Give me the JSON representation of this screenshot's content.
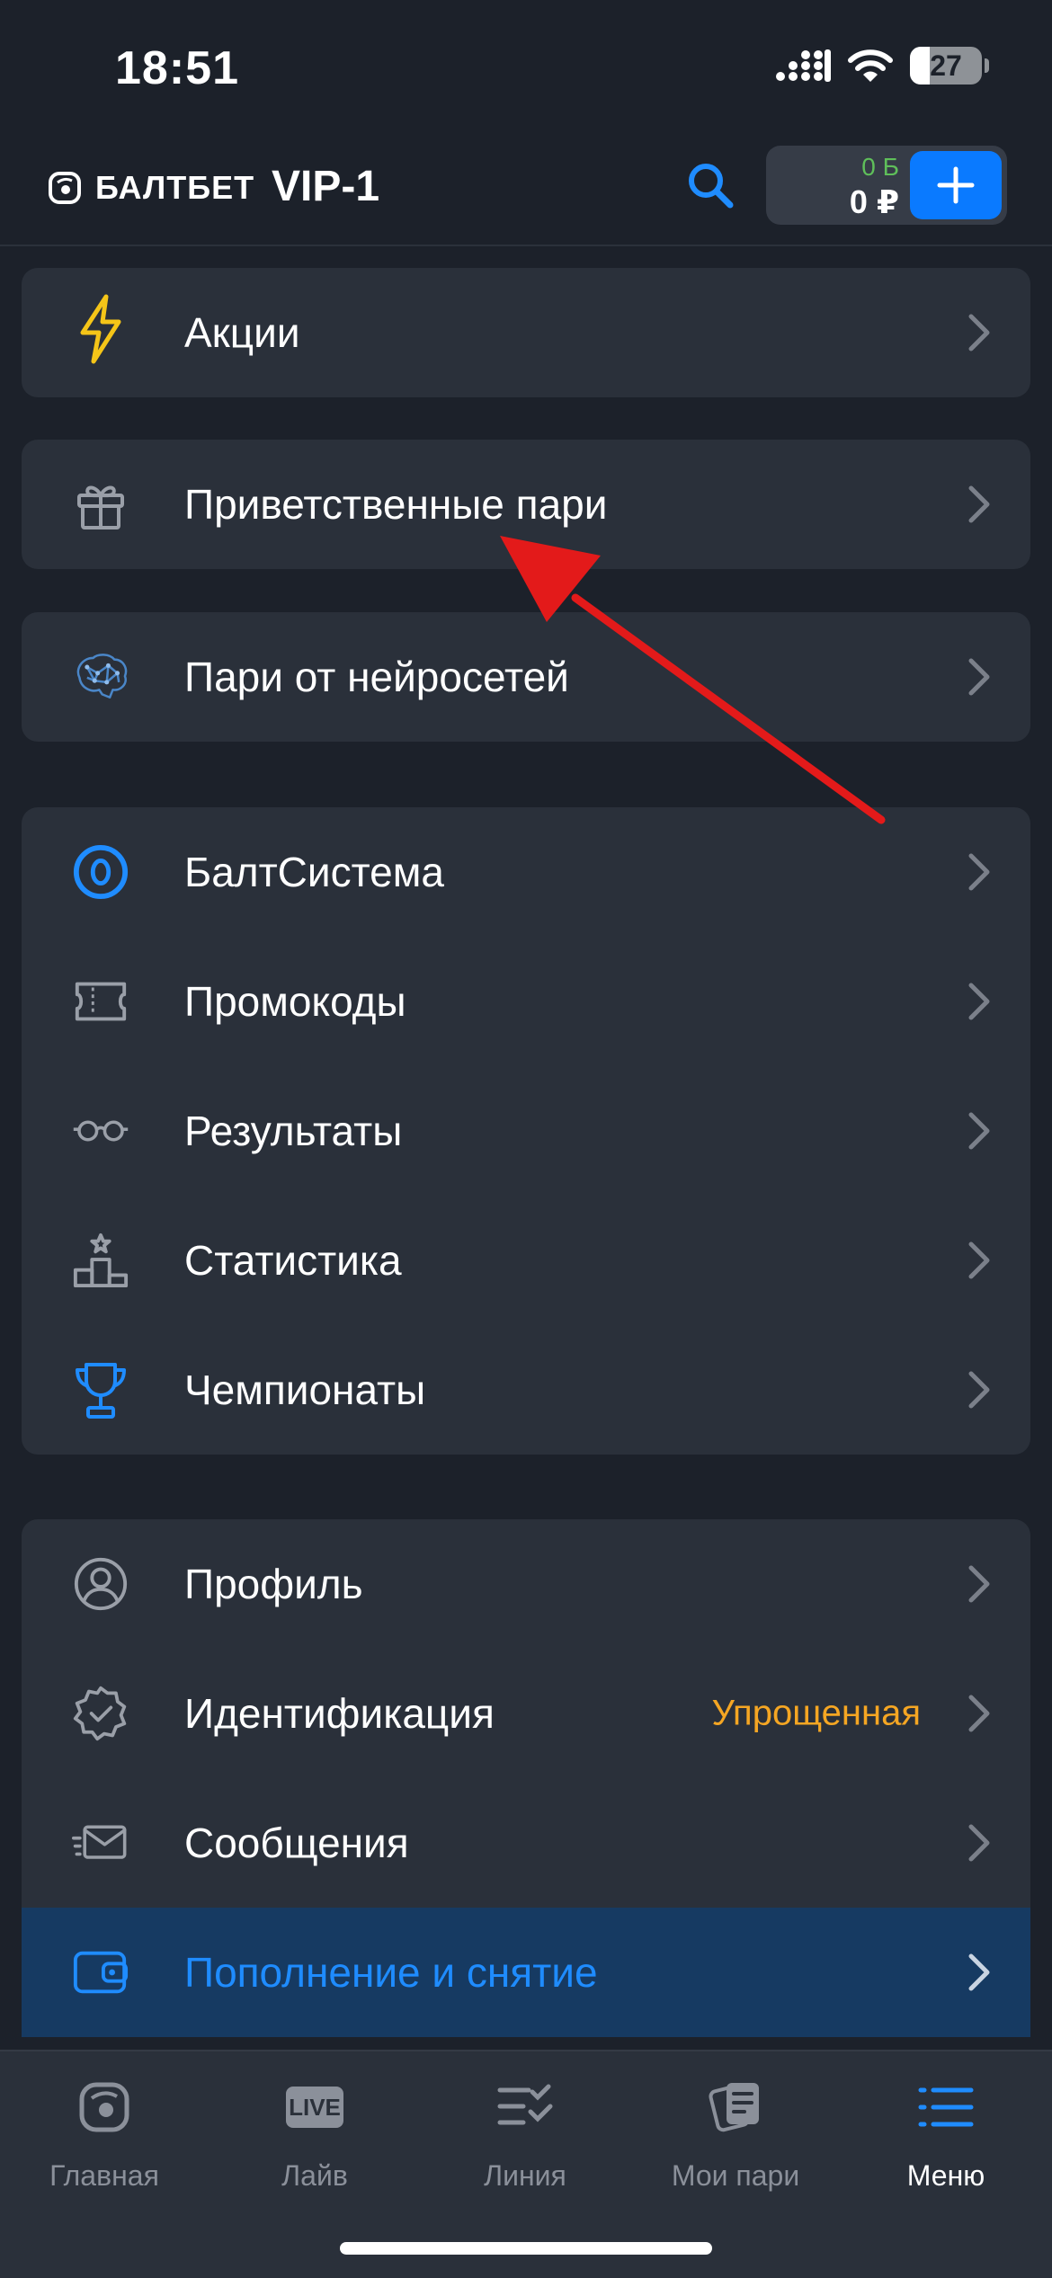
{
  "status_bar": {
    "time": "18:51",
    "battery": "27",
    "battery_level": 0.27
  },
  "header": {
    "logo_text": "БАЛТБЕТ",
    "vip_level": "VIP-1",
    "bonus_balance": "0 Б",
    "balance": "0 ₽"
  },
  "menu": {
    "group1": [
      {
        "label": "Акции",
        "icon": "lightning-icon"
      }
    ],
    "group2": [
      {
        "label": "Приветственные пари",
        "icon": "gift-icon"
      }
    ],
    "group3": [
      {
        "label": "Пари от нейросетей",
        "icon": "brain-icon"
      }
    ],
    "group4": [
      {
        "label": "БалтСистема",
        "icon": "baltsystem-icon"
      },
      {
        "label": "Промокоды",
        "icon": "ticket-icon"
      },
      {
        "label": "Результаты",
        "icon": "glasses-icon"
      },
      {
        "label": "Статистика",
        "icon": "podium-icon"
      },
      {
        "label": "Чемпионаты",
        "icon": "trophy-icon"
      }
    ],
    "group5": [
      {
        "label": "Профиль",
        "icon": "profile-icon"
      },
      {
        "label": "Идентификация",
        "icon": "verified-badge-icon",
        "badge": "Упрощенная"
      },
      {
        "label": "Сообщения",
        "icon": "mail-icon"
      },
      {
        "label": "Пополнение и снятие",
        "icon": "wallet-icon"
      }
    ]
  },
  "tabbar": [
    {
      "label": "Главная",
      "icon": "home-icon"
    },
    {
      "label": "Лайв",
      "icon": "live-icon",
      "icon_text": "LIVE"
    },
    {
      "label": "Линия",
      "icon": "line-icon"
    },
    {
      "label": "Мои пари",
      "icon": "my-bets-icon"
    },
    {
      "label": "Меню",
      "icon": "menu-icon"
    }
  ],
  "colors": {
    "background": "#1c212a",
    "card": "#2a303a",
    "accent": "#0a7aff",
    "badge": "#f5a623",
    "bonus": "#5fbf5a",
    "annotation_arrow": "#e31a1a"
  }
}
